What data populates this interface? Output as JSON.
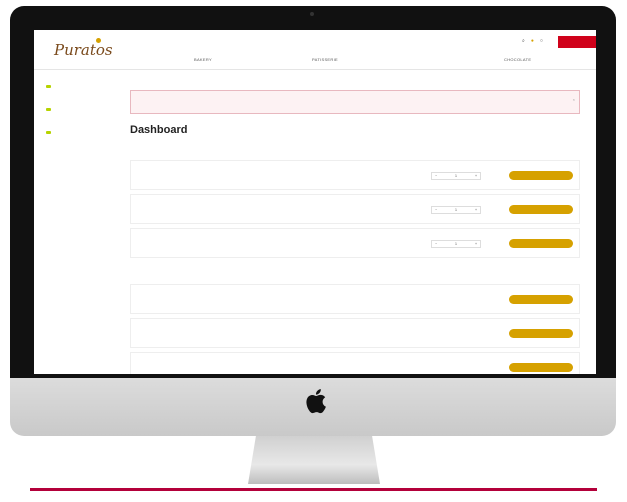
{
  "header": {
    "logo": "Puratos",
    "top_links": [
      "",
      "",
      "",
      "",
      "",
      "",
      ""
    ],
    "main_nav": [
      "BAKERY",
      "PATISSERIE",
      "CHOCOLATE"
    ],
    "logout_label": ""
  },
  "colors": {
    "brand_red": "#c80032",
    "gold": "#d6a100",
    "badge_green": "#b6d300"
  },
  "sidebar": {
    "groups": [
      {
        "heading": "",
        "items": [
          "",
          ""
        ]
      },
      {
        "heading": "",
        "items": [
          "",
          "",
          "",
          ""
        ]
      },
      {
        "heading": "",
        "items": [
          "",
          "",
          ""
        ]
      },
      {
        "heading": "",
        "items": [
          "",
          ""
        ]
      },
      {
        "heading": "",
        "items": [
          ""
        ]
      },
      {
        "heading": "",
        "items": [
          "",
          ""
        ]
      }
    ]
  },
  "alert": {
    "text_before": "",
    "text_bold": "",
    "text_after": "",
    "link": ""
  },
  "page": {
    "title": "Dashboard",
    "top_right_label": "",
    "top_right_link": ""
  },
  "sections": {
    "favourites_label": "",
    "orders_label": "",
    "see_all": ""
  },
  "favourites": [
    {
      "name": "",
      "desc": "",
      "col1_k": "",
      "col1_v": "",
      "col2_k": "",
      "col2_v": "",
      "col3_k": "",
      "col3_v": "",
      "qty": "1",
      "button": ""
    },
    {
      "name": "",
      "desc": "",
      "col1_k": "",
      "col1_v": "",
      "col2_k": "",
      "col2_v": "",
      "col3_k": "",
      "col3_v": "",
      "qty": "1",
      "button": ""
    },
    {
      "name": "",
      "desc": "",
      "col1_k": "",
      "col1_v": "",
      "col2_k": "",
      "col2_v": "",
      "col3_k": "",
      "col3_v": "",
      "qty": "1",
      "button": ""
    }
  ],
  "orders": [
    {
      "number": "",
      "sub": "",
      "c1_k": "",
      "c1_v": "",
      "c2_k": "",
      "c2_v": "",
      "c3_k": "",
      "c3_v": "",
      "c4_k": "",
      "c4_v": "",
      "button": ""
    },
    {
      "number": "",
      "sub": "",
      "c1_k": "",
      "c1_v": "",
      "c2_k": "",
      "c2_v": "",
      "c3_k": "",
      "c3_v": "",
      "c4_k": "",
      "c4_v": "",
      "button": ""
    },
    {
      "number": "",
      "sub": "",
      "c1_k": "",
      "c1_v": "",
      "c2_k": "",
      "c2_v": "",
      "c3_k": "",
      "c3_v": "",
      "c4_k": "",
      "c4_v": "",
      "button": ""
    }
  ],
  "icons": [
    "search-icon",
    "cart-icon",
    "user-icon",
    "close-icon",
    "minus-icon",
    "plus-icon",
    "apple-logo-icon"
  ]
}
